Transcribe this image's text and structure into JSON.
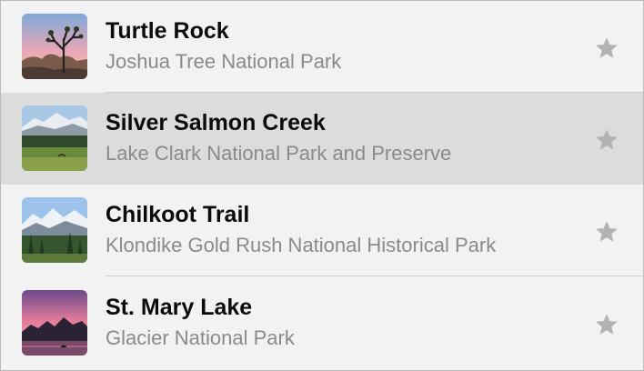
{
  "landmarks": [
    {
      "name": "Turtle Rock",
      "park": "Joshua Tree National Park",
      "image_icon": "joshua-tree-photo",
      "favorite_icon": "star-icon",
      "selected": false
    },
    {
      "name": "Silver Salmon Creek",
      "park": "Lake Clark National Park and Preserve",
      "image_icon": "mountain-meadow-photo",
      "favorite_icon": "star-icon",
      "selected": true
    },
    {
      "name": "Chilkoot Trail",
      "park": "Klondike Gold Rush National Historical Park",
      "image_icon": "forest-mountain-photo",
      "favorite_icon": "star-icon",
      "selected": false
    },
    {
      "name": "St. Mary Lake",
      "park": "Glacier National Park",
      "image_icon": "sunset-lake-photo",
      "favorite_icon": "star-icon",
      "selected": false
    }
  ],
  "colors": {
    "background": "#f2f2f2",
    "selected_row": "#dcdcdc",
    "title_text": "#0b0b0b",
    "subtitle_text": "#8a8a8a",
    "star": "#b3b3b3"
  }
}
